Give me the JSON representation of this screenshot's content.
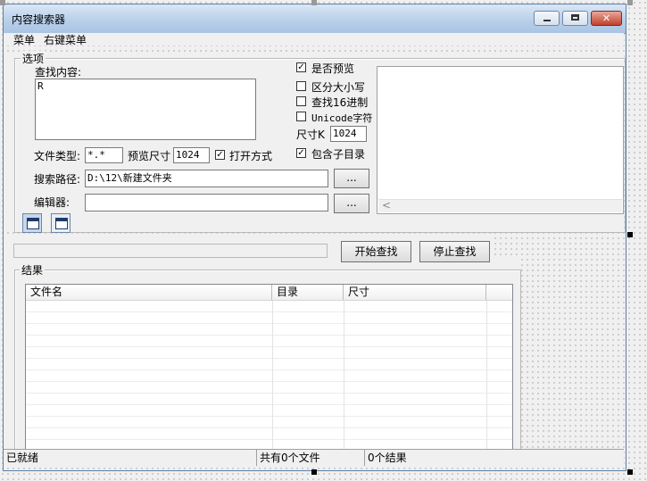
{
  "window": {
    "title": "内容搜索器"
  },
  "menu": [
    {
      "label": "菜单"
    },
    {
      "label": "右键菜单"
    }
  ],
  "options": {
    "group_title": "选项",
    "search_label": "查找内容:",
    "search_value": "R",
    "file_type_label": "文件类型:",
    "file_type_value": "*.*",
    "preview_size_label": "预览尺寸",
    "preview_size_value": "1024",
    "open_mode_label": "打开方式",
    "open_mode_checked": true,
    "search_path_label": "搜索路径:",
    "search_path_value": "D:\\12\\新建文件夹",
    "browse_label": "...",
    "editor_label": "编辑器:",
    "editor_value": "",
    "editor_browse_label": "...",
    "checks": [
      {
        "label": "是否预览",
        "checked": true
      },
      {
        "label": "区分大小写",
        "checked": false
      },
      {
        "label": "查找16进制",
        "checked": false
      },
      {
        "label": "Unicode字符",
        "checked": false
      }
    ],
    "size_k_label": "尺寸K",
    "size_k_value": "1024",
    "include_subdir_label": "包含子目录",
    "include_subdir_checked": true,
    "preview_scroll_arrow": "<"
  },
  "actions": {
    "start_label": "开始查找",
    "stop_label": "停止查找"
  },
  "results": {
    "group_title": "结果",
    "columns": [
      {
        "label": "文件名"
      },
      {
        "label": "目录"
      },
      {
        "label": "尺寸"
      }
    ]
  },
  "status": {
    "ready": "已就绪",
    "file_count": "共有0个文件",
    "result_count": "0个结果"
  }
}
